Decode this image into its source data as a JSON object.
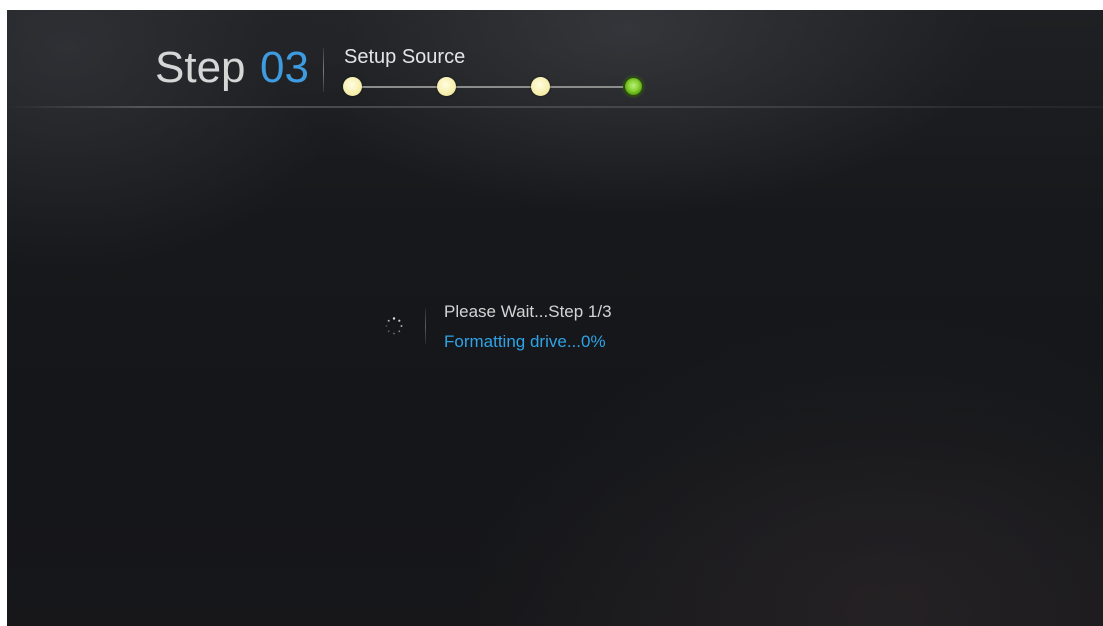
{
  "header": {
    "step_word": "Step",
    "step_number": "03",
    "step_label": "Setup Source"
  },
  "wizard_progress": {
    "total_steps": 4,
    "current_step": 4
  },
  "status": {
    "line1": "Please Wait...Step 1/3",
    "line2": "Formatting drive...0%",
    "progress_percent": 0,
    "spinner_icon": "loading-spinner-icon"
  },
  "colors": {
    "accent_blue": "#3e9be0",
    "status_blue": "#2ea3e6",
    "dot_done": "#f7f0b0",
    "dot_active": "#8bd436"
  }
}
